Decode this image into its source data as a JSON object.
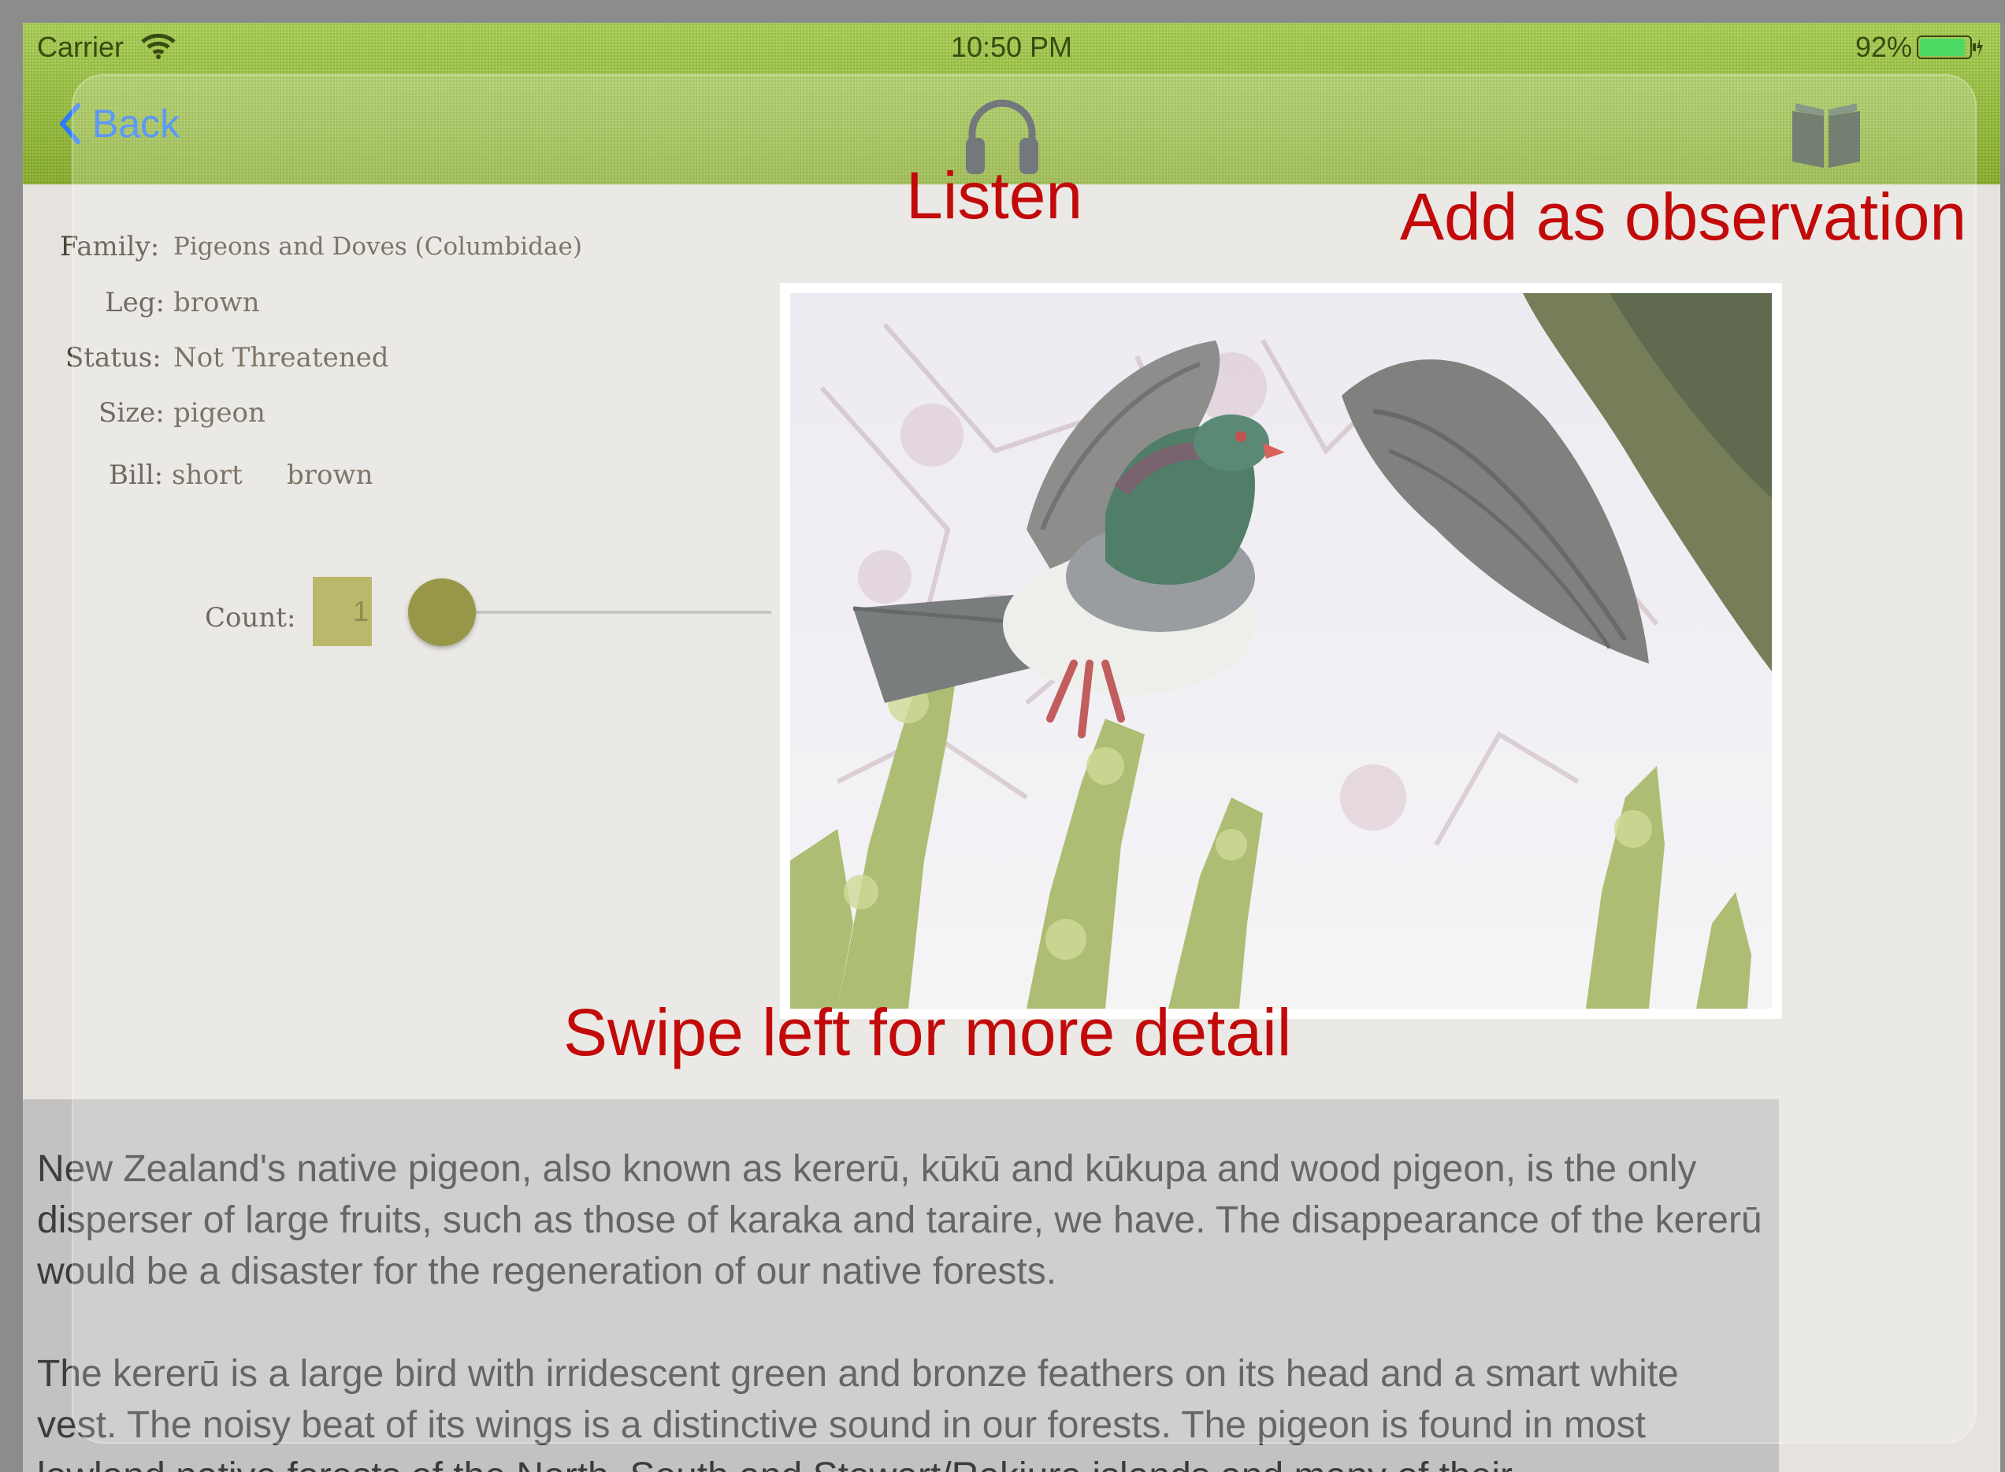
{
  "status_bar": {
    "carrier": "Carrier",
    "time": "10:50 PM",
    "battery": "92%",
    "battery_level": 0.92
  },
  "nav": {
    "back_label": "Back",
    "listen_icon": "headphones-icon",
    "observation_icon": "book-icon"
  },
  "details": {
    "family": {
      "label": "Family:",
      "value": "Pigeons and Doves (Columbidae)"
    },
    "leg": {
      "label": "Leg:",
      "value": "brown"
    },
    "status": {
      "label": "Status:",
      "value": "Not Threatened"
    },
    "size": {
      "label": "Size:",
      "value": "pigeon"
    },
    "bill": {
      "label": "Bill:",
      "value_shape": "short",
      "value_color": "brown"
    }
  },
  "count": {
    "label": "Count:",
    "value": "1",
    "slider_fraction": 0.05
  },
  "description": {
    "paragraph_1": "New Zealand's native pigeon, also known as kererū, kūkū and kūkupa and wood pigeon, is the only disperser of large fruits, such as those of karaka and taraire, we have. The disappearance of the kererū would be a disaster for the regeneration of our native forests.",
    "paragraph_2": "The kererū is a large bird with irridescent green and bronze feathers on its head and a smart white vest. The noisy beat of its wings is a distinctive sound in our forests. The pigeon is found in most lowland native forests of the North, South and Stewart/Rakiura islands and many of their"
  },
  "hints": {
    "listen": "Listen",
    "observation": "Add as observation",
    "swipe": "Swipe left for more detail"
  },
  "colors": {
    "nav_green": "#95bd38",
    "accent_blue": "#2f7bf5",
    "hint_red": "#c20a0a",
    "count_olive": "#a7a442"
  }
}
